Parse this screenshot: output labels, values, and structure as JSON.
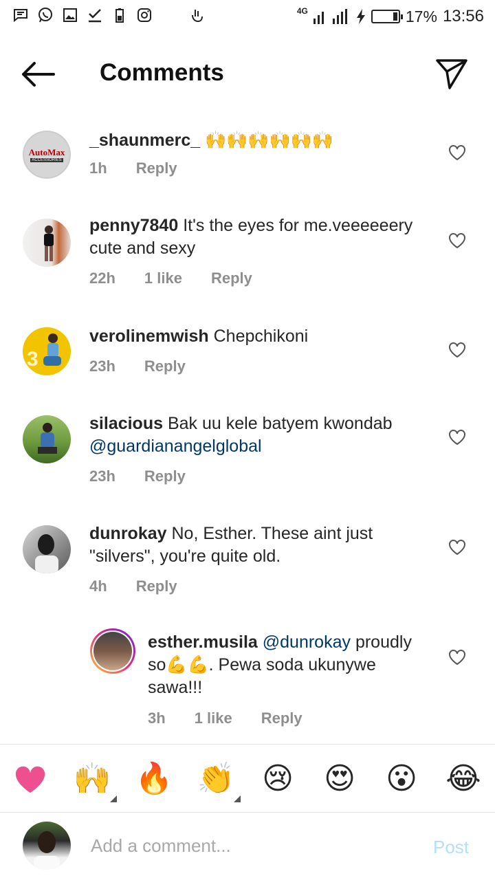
{
  "status_bar": {
    "network": "4G",
    "battery": "17%",
    "battery_level": 0.17,
    "time": "13:56",
    "icons": [
      "message-icon",
      "whatsapp-icon",
      "gallery-icon",
      "download-done-icon",
      "battery-saver-icon",
      "instagram-icon",
      "touch-icon",
      "signal-icon",
      "charging-icon",
      "battery-icon"
    ]
  },
  "header": {
    "title": "Comments",
    "back_icon": "arrow-left-icon",
    "send_icon": "paper-plane-icon"
  },
  "comments": [
    {
      "username": "_shaunmerc_",
      "text": "🙌🙌🙌🙌🙌🙌",
      "time": "1h",
      "likes": "",
      "reply": "Reply",
      "avatar_text": "AutoMax",
      "avatar_subtext": "ACCESSORIES"
    },
    {
      "username": "penny7840",
      "text": "It's the eyes for me.veeeeeery cute and sexy",
      "time": "22h",
      "likes": "1 like",
      "reply": "Reply"
    },
    {
      "username": "verolinemwish",
      "text": "Chepchikoni",
      "time": "23h",
      "likes": "",
      "reply": "Reply"
    },
    {
      "username": "silacious",
      "text": "Bak uu kele batyem kwondab",
      "mention": "@guardianangelglobal",
      "time": "23h",
      "likes": "",
      "reply": "Reply"
    },
    {
      "username": "dunrokay",
      "text": "No, Esther. These aint just \"silvers\", you're quite old.",
      "time": "4h",
      "likes": "",
      "reply": "Reply"
    },
    {
      "username": "esther.musila",
      "mention": "@dunrokay",
      "text": "proudly so💪💪. Pewa soda ukunywe sawa!!!",
      "time": "3h",
      "likes": "1 like",
      "reply": "Reply"
    }
  ],
  "emoji_bar": [
    "❤️",
    "🙌",
    "🔥",
    "👏",
    "😢",
    "😍",
    "😮",
    "😂"
  ],
  "input": {
    "placeholder": "Add a comment...",
    "post": "Post"
  },
  "colors": {
    "mention": "#00376b",
    "meta": "#8e8e8e",
    "post": "#b2dffc",
    "heart": "#ed4f8f"
  }
}
